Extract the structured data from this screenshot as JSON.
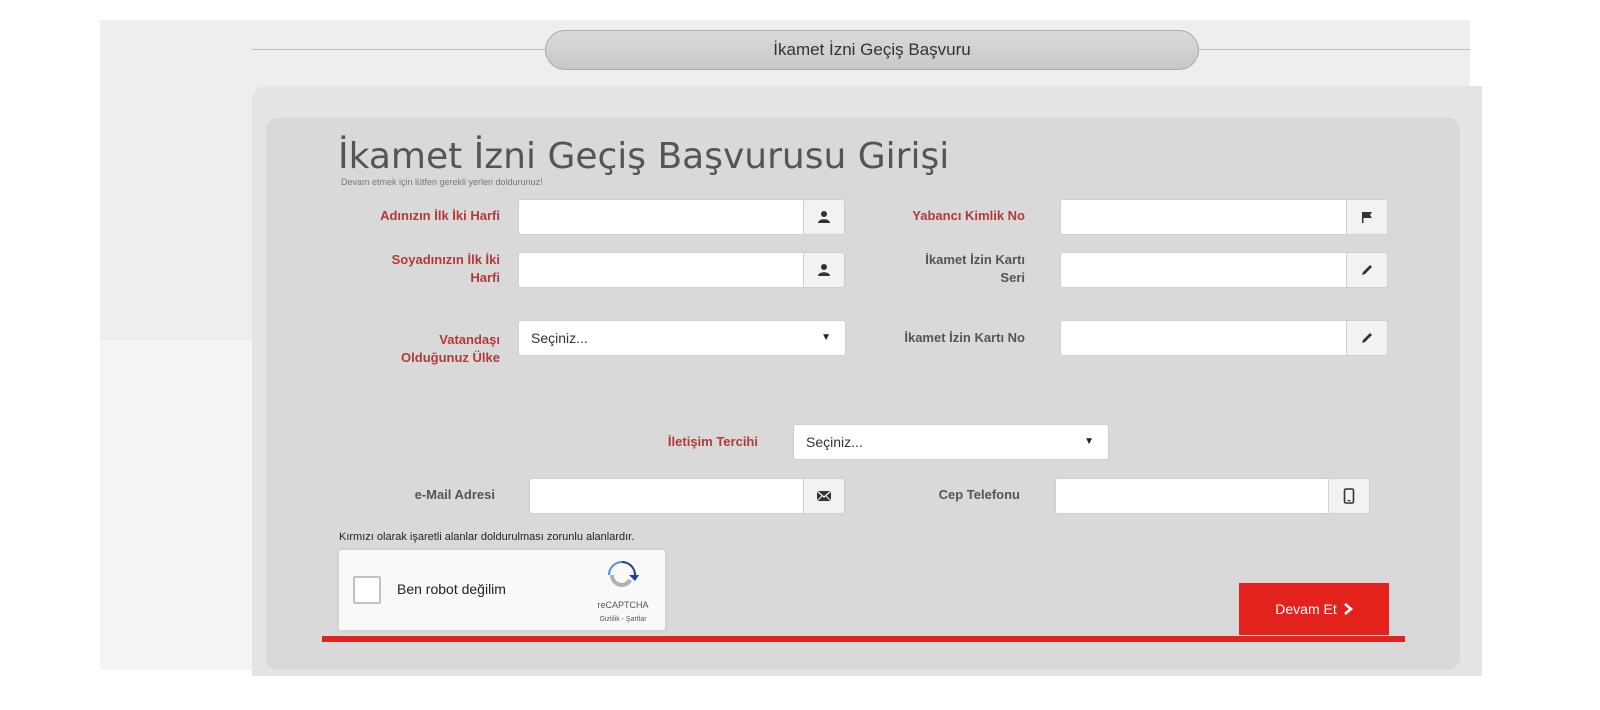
{
  "header": {
    "title": "İkamet İzni Geçiş Başvuru"
  },
  "form": {
    "title": "İkamet İzni Geçiş Başvurusu Girişi",
    "subtitle": "Devam etmek için lütfen gerekli yerleri doldurunuz!",
    "fields": {
      "first_name_initials": {
        "label": "Adınızın İlk İki Harfi",
        "value": "",
        "icon": "user-icon"
      },
      "surname_initials": {
        "label_line1": "Soyadınızın İlk İki",
        "label_line2": "Harfi",
        "value": "",
        "icon": "user-icon"
      },
      "citizenship_country": {
        "label_line1": "Vatandaşı",
        "label_line2": "Olduğunuz Ülke",
        "selected": "Seçiniz..."
      },
      "foreign_id_no": {
        "label": "Yabancı Kimlik No",
        "value": "",
        "icon": "flag-icon"
      },
      "residence_card_serial": {
        "label_line1": "İkamet İzin Kartı",
        "label_line2": "Seri",
        "value": "",
        "icon": "pencil-icon"
      },
      "residence_card_no": {
        "label": "İkamet İzin Kartı No",
        "value": "",
        "icon": "pencil-icon"
      },
      "contact_preference": {
        "label": "İletişim Tercihi",
        "selected": "Seçiniz..."
      },
      "email": {
        "label": "e-Mail Adresi",
        "value": "",
        "icon": "envelope-icon"
      },
      "mobile_phone": {
        "label": "Cep Telefonu",
        "value": "",
        "icon": "mobile-icon"
      }
    },
    "required_note": "Kırmızı olarak işaretli alanlar doldurulması zorunlu alanlardır.",
    "captcha": {
      "label": "Ben robot değilim",
      "brand": "reCAPTCHA",
      "terms": "Gizlilik - Şartlar"
    },
    "submit_label": "Devam Et",
    "colors": {
      "required_label": "#b03a3a",
      "submit": "#e3221e"
    }
  }
}
